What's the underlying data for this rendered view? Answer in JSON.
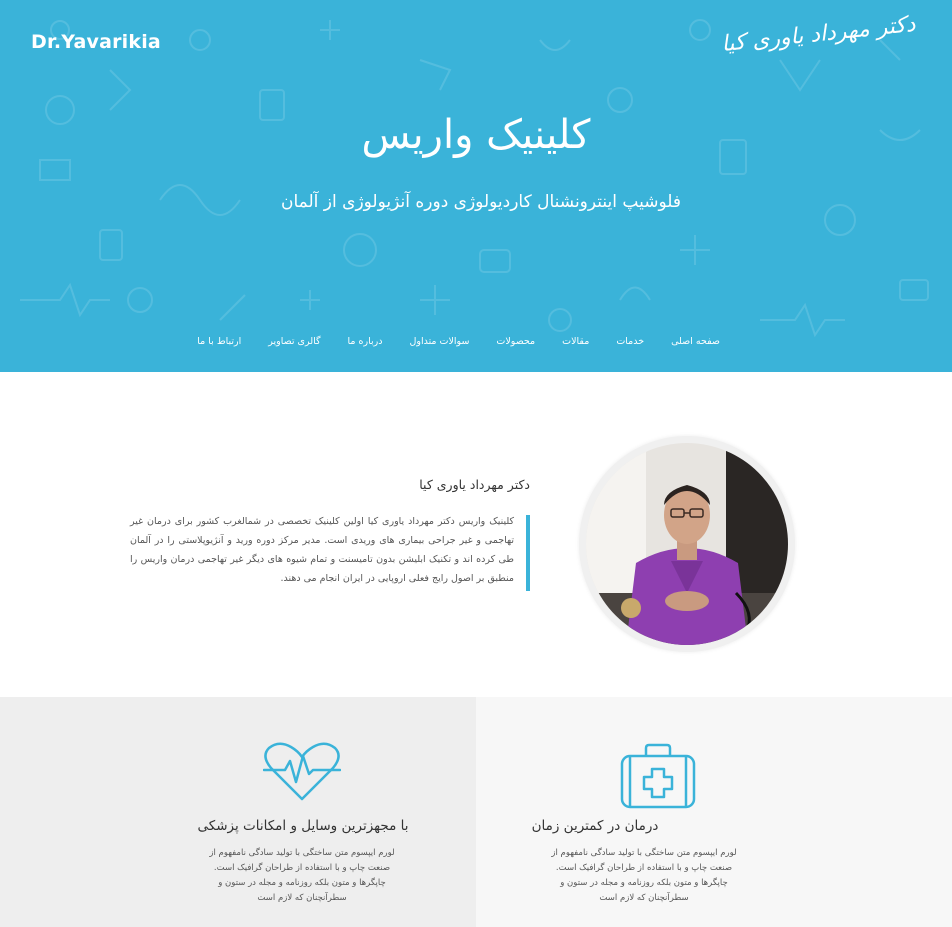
{
  "header": {
    "brand_en": "Dr.Yavarikia",
    "brand_fa": "دکتر مهرداد یاوری کیا",
    "title": "کلینیک واریس",
    "subtitle": "فلوشیپ اینترونشنال کاردیولوژی دوره آنژیولوژی از آلمان",
    "bg_color": "#3ab3d9"
  },
  "nav": {
    "items": [
      {
        "label": "صفحه اصلی"
      },
      {
        "label": "خدمات"
      },
      {
        "label": "مقالات"
      },
      {
        "label": "محصولات"
      },
      {
        "label": "سوالات متداول"
      },
      {
        "label": "درباره ما"
      },
      {
        "label": "گالری تصاویر"
      },
      {
        "label": "ارتباط با ما"
      }
    ]
  },
  "about": {
    "name": "دکتر مهرداد یاوری کیا",
    "text": "کلینیک واریس دکتر مهرداد یاوری کیا اولین کلینیک تخصصی در شمالغرب کشور برای درمان غیر تهاجمی و غیر جراحی بیماری های وریدی است. مدیر مرکز دوره ورید و آنژیوپلاستی را در آلمان طی کرده اند و تکنیک ابلیشن بدون تامیسنت و تمام شیوه های دیگر غیر تهاجمی درمان واریس را منطبق بر اصول رایج فعلی اروپایی در ایران انجام می دهند.",
    "accent": "#3ab3d9"
  },
  "features": [
    {
      "icon": "medical-kit-icon",
      "title": "درمان در کمترین زمان",
      "desc": "لورم ایپسوم متن ساختگی با تولید سادگی نامفهوم از صنعت چاپ و با استفاده از طراحان گرافیک است. چاپگرها و متون بلکه روزنامه و مجله در ستون و سطرآنچنان که لازم است"
    },
    {
      "icon": "heart-pulse-icon",
      "title": "با مجهزترین وسایل و امکانات پزشکی",
      "desc": "لورم ایپسوم متن ساختگی با تولید سادگی نامفهوم از صنعت چاپ و با استفاده از طراحان گرافیک است. چاپگرها و متون بلکه روزنامه و مجله در ستون و سطرآنچنان که لازم است"
    }
  ]
}
